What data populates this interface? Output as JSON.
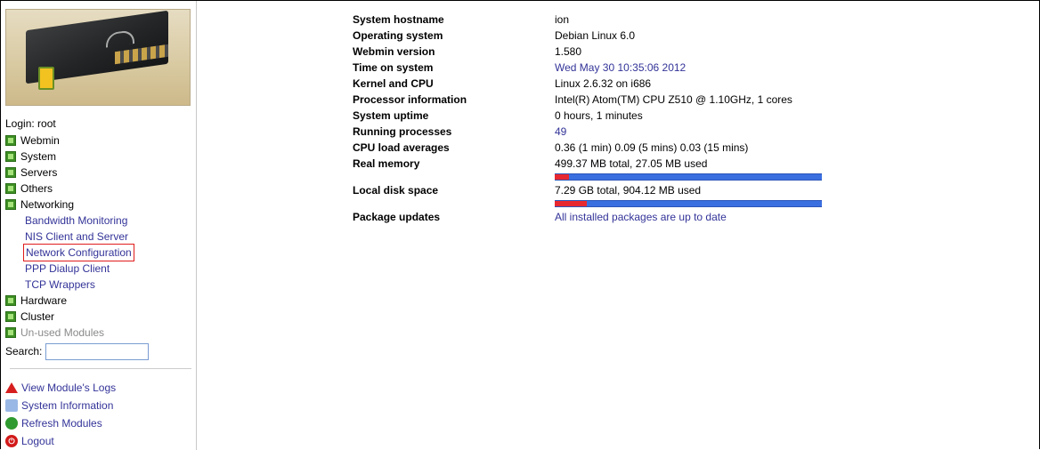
{
  "sidebar": {
    "login_text": "Login: root",
    "categories": [
      {
        "label": "Webmin"
      },
      {
        "label": "System"
      },
      {
        "label": "Servers"
      },
      {
        "label": "Others"
      },
      {
        "label": "Networking"
      }
    ],
    "networking_items": [
      {
        "label": "Bandwidth Monitoring"
      },
      {
        "label": "NIS Client and Server"
      },
      {
        "label": "Network Configuration",
        "selected": true
      },
      {
        "label": "PPP Dialup Client"
      },
      {
        "label": "TCP Wrappers"
      }
    ],
    "categories_after": [
      {
        "label": "Hardware"
      },
      {
        "label": "Cluster"
      },
      {
        "label": "Un-used Modules"
      }
    ],
    "search_label": "Search:",
    "search_value": "",
    "actions": [
      {
        "label": "View Module's Logs",
        "icon": "warning-icon"
      },
      {
        "label": "System Information",
        "icon": "home-icon"
      },
      {
        "label": "Refresh Modules",
        "icon": "refresh-icon"
      },
      {
        "label": "Logout",
        "icon": "logout-icon"
      }
    ]
  },
  "system_info": {
    "rows": [
      {
        "label": "System hostname",
        "value": "ion"
      },
      {
        "label": "Operating system",
        "value": "Debian Linux 6.0"
      },
      {
        "label": "Webmin version",
        "value": "1.580"
      },
      {
        "label": "Time on system",
        "value": "Wed May 30 10:35:06 2012"
      },
      {
        "label": "Kernel and CPU",
        "value": "Linux 2.6.32 on i686"
      },
      {
        "label": "Processor information",
        "value": "Intel(R) Atom(TM) CPU Z510 @ 1.10GHz, 1 cores"
      },
      {
        "label": "System uptime",
        "value": "0 hours, 1 minutes"
      },
      {
        "label": "Running processes",
        "value": "49"
      },
      {
        "label": "CPU load averages",
        "value": "0.36 (1 min) 0.09 (5 mins) 0.03 (15 mins)"
      },
      {
        "label": "Real memory",
        "value": "499.37 MB total, 27.05 MB used",
        "usage_fraction": 0.054
      },
      {
        "label": "Local disk space",
        "value": "7.29 GB total, 904.12 MB used",
        "usage_fraction": 0.121
      },
      {
        "label": "Package updates",
        "value": "All installed packages are up to date"
      }
    ]
  },
  "colors": {
    "link": "#333399",
    "bar_used": "#e8282f",
    "bar_free": "#3a6fe0",
    "selected_border": "#e01b1b"
  }
}
